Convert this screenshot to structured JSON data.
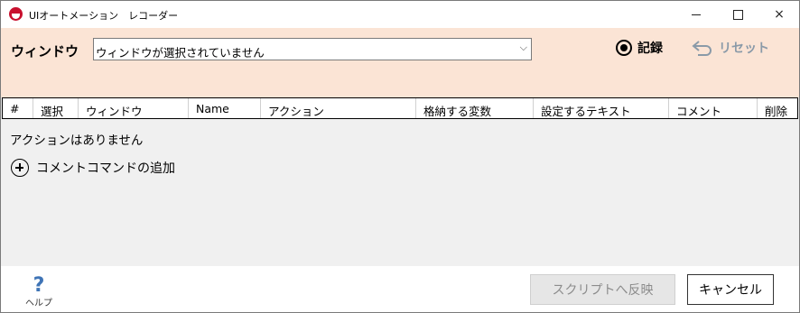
{
  "window": {
    "title": "UIオートメーション　レコーダー",
    "app_icon": "red-record-app-icon",
    "controls": {
      "minimize": "minimize-icon",
      "maximize": "maximize-icon",
      "close": "×"
    }
  },
  "toolbar": {
    "window_label": "ウィンドウ",
    "window_select_value": "ウィンドウが選択されていません",
    "record_label": "記録",
    "reset_label": "リセット",
    "reset_color": "#8a9aa8"
  },
  "table": {
    "headers": [
      "#",
      "選択",
      "ウィンドウ",
      "Name",
      "アクション",
      "格納する変数",
      "設定するテキスト",
      "コメント",
      "削除"
    ]
  },
  "content": {
    "empty_message": "アクションはありません",
    "add_comment_label": "コメントコマンドの追加"
  },
  "footer": {
    "help_icon": "?",
    "help_label": "ヘルプ",
    "help_color": "#3f74b6",
    "script_button_label": "スクリプトへ反映",
    "cancel_button_label": "キャンセル"
  },
  "colors": {
    "toolbar_bg": "#fbe4d5",
    "content_bg": "#f0f0f0"
  }
}
